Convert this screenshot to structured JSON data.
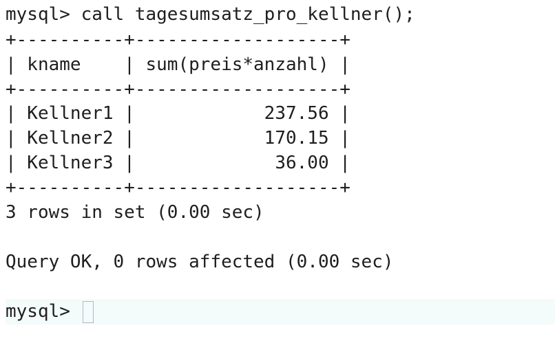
{
  "terminal": {
    "command": "mysql> call tagesumsatz_pro_kellner();",
    "table": {
      "border_top": "+----------+-------------------+",
      "header_row": "| kname    | sum(preis*anzahl) |",
      "border_mid": "+----------+-------------------+",
      "rows": [
        {
          "text": "| Kellner1 |            237.56 |",
          "kname": "Kellner1",
          "sum": "237.56"
        },
        {
          "text": "| Kellner2 |            170.15 |",
          "kname": "Kellner2",
          "sum": "170.15"
        },
        {
          "text": "| Kellner3 |             36.00 |",
          "kname": "Kellner3",
          "sum": "36.00"
        }
      ],
      "border_bottom": "+----------+-------------------+"
    },
    "result_summary": "3 rows in set (0.00 sec)",
    "query_status": "Query OK, 0 rows affected (0.00 sec)",
    "prompt": "mysql>"
  },
  "colors": {
    "background": "#ffffff",
    "text": "#1e1e1e",
    "active_line": "#f3fbfb",
    "cursor_border": "#b8b8b8"
  }
}
